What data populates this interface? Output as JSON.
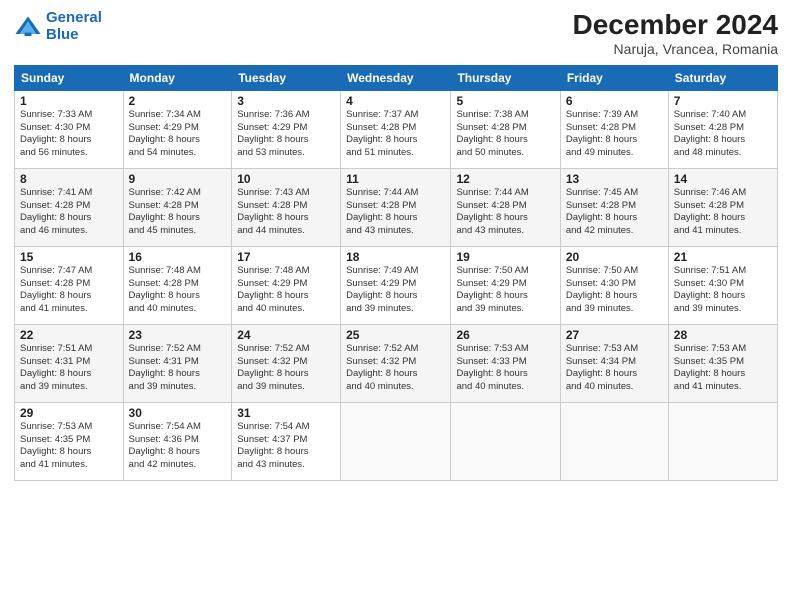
{
  "logo": {
    "line1": "General",
    "line2": "Blue"
  },
  "title": "December 2024",
  "subtitle": "Naruja, Vrancea, Romania",
  "weekdays": [
    "Sunday",
    "Monday",
    "Tuesday",
    "Wednesday",
    "Thursday",
    "Friday",
    "Saturday"
  ],
  "weeks": [
    [
      {
        "day": "1",
        "sunrise": "7:33 AM",
        "sunset": "4:30 PM",
        "daylight": "8 hours and 56 minutes."
      },
      {
        "day": "2",
        "sunrise": "7:34 AM",
        "sunset": "4:29 PM",
        "daylight": "8 hours and 54 minutes."
      },
      {
        "day": "3",
        "sunrise": "7:36 AM",
        "sunset": "4:29 PM",
        "daylight": "8 hours and 53 minutes."
      },
      {
        "day": "4",
        "sunrise": "7:37 AM",
        "sunset": "4:28 PM",
        "daylight": "8 hours and 51 minutes."
      },
      {
        "day": "5",
        "sunrise": "7:38 AM",
        "sunset": "4:28 PM",
        "daylight": "8 hours and 50 minutes."
      },
      {
        "day": "6",
        "sunrise": "7:39 AM",
        "sunset": "4:28 PM",
        "daylight": "8 hours and 49 minutes."
      },
      {
        "day": "7",
        "sunrise": "7:40 AM",
        "sunset": "4:28 PM",
        "daylight": "8 hours and 48 minutes."
      }
    ],
    [
      {
        "day": "8",
        "sunrise": "7:41 AM",
        "sunset": "4:28 PM",
        "daylight": "8 hours and 46 minutes."
      },
      {
        "day": "9",
        "sunrise": "7:42 AM",
        "sunset": "4:28 PM",
        "daylight": "8 hours and 45 minutes."
      },
      {
        "day": "10",
        "sunrise": "7:43 AM",
        "sunset": "4:28 PM",
        "daylight": "8 hours and 44 minutes."
      },
      {
        "day": "11",
        "sunrise": "7:44 AM",
        "sunset": "4:28 PM",
        "daylight": "8 hours and 43 minutes."
      },
      {
        "day": "12",
        "sunrise": "7:44 AM",
        "sunset": "4:28 PM",
        "daylight": "8 hours and 43 minutes."
      },
      {
        "day": "13",
        "sunrise": "7:45 AM",
        "sunset": "4:28 PM",
        "daylight": "8 hours and 42 minutes."
      },
      {
        "day": "14",
        "sunrise": "7:46 AM",
        "sunset": "4:28 PM",
        "daylight": "8 hours and 41 minutes."
      }
    ],
    [
      {
        "day": "15",
        "sunrise": "7:47 AM",
        "sunset": "4:28 PM",
        "daylight": "8 hours and 41 minutes."
      },
      {
        "day": "16",
        "sunrise": "7:48 AM",
        "sunset": "4:28 PM",
        "daylight": "8 hours and 40 minutes."
      },
      {
        "day": "17",
        "sunrise": "7:48 AM",
        "sunset": "4:29 PM",
        "daylight": "8 hours and 40 minutes."
      },
      {
        "day": "18",
        "sunrise": "7:49 AM",
        "sunset": "4:29 PM",
        "daylight": "8 hours and 39 minutes."
      },
      {
        "day": "19",
        "sunrise": "7:50 AM",
        "sunset": "4:29 PM",
        "daylight": "8 hours and 39 minutes."
      },
      {
        "day": "20",
        "sunrise": "7:50 AM",
        "sunset": "4:30 PM",
        "daylight": "8 hours and 39 minutes."
      },
      {
        "day": "21",
        "sunrise": "7:51 AM",
        "sunset": "4:30 PM",
        "daylight": "8 hours and 39 minutes."
      }
    ],
    [
      {
        "day": "22",
        "sunrise": "7:51 AM",
        "sunset": "4:31 PM",
        "daylight": "8 hours and 39 minutes."
      },
      {
        "day": "23",
        "sunrise": "7:52 AM",
        "sunset": "4:31 PM",
        "daylight": "8 hours and 39 minutes."
      },
      {
        "day": "24",
        "sunrise": "7:52 AM",
        "sunset": "4:32 PM",
        "daylight": "8 hours and 39 minutes."
      },
      {
        "day": "25",
        "sunrise": "7:52 AM",
        "sunset": "4:32 PM",
        "daylight": "8 hours and 40 minutes."
      },
      {
        "day": "26",
        "sunrise": "7:53 AM",
        "sunset": "4:33 PM",
        "daylight": "8 hours and 40 minutes."
      },
      {
        "day": "27",
        "sunrise": "7:53 AM",
        "sunset": "4:34 PM",
        "daylight": "8 hours and 40 minutes."
      },
      {
        "day": "28",
        "sunrise": "7:53 AM",
        "sunset": "4:35 PM",
        "daylight": "8 hours and 41 minutes."
      }
    ],
    [
      {
        "day": "29",
        "sunrise": "7:53 AM",
        "sunset": "4:35 PM",
        "daylight": "8 hours and 41 minutes."
      },
      {
        "day": "30",
        "sunrise": "7:54 AM",
        "sunset": "4:36 PM",
        "daylight": "8 hours and 42 minutes."
      },
      {
        "day": "31",
        "sunrise": "7:54 AM",
        "sunset": "4:37 PM",
        "daylight": "8 hours and 43 minutes."
      },
      null,
      null,
      null,
      null
    ]
  ]
}
